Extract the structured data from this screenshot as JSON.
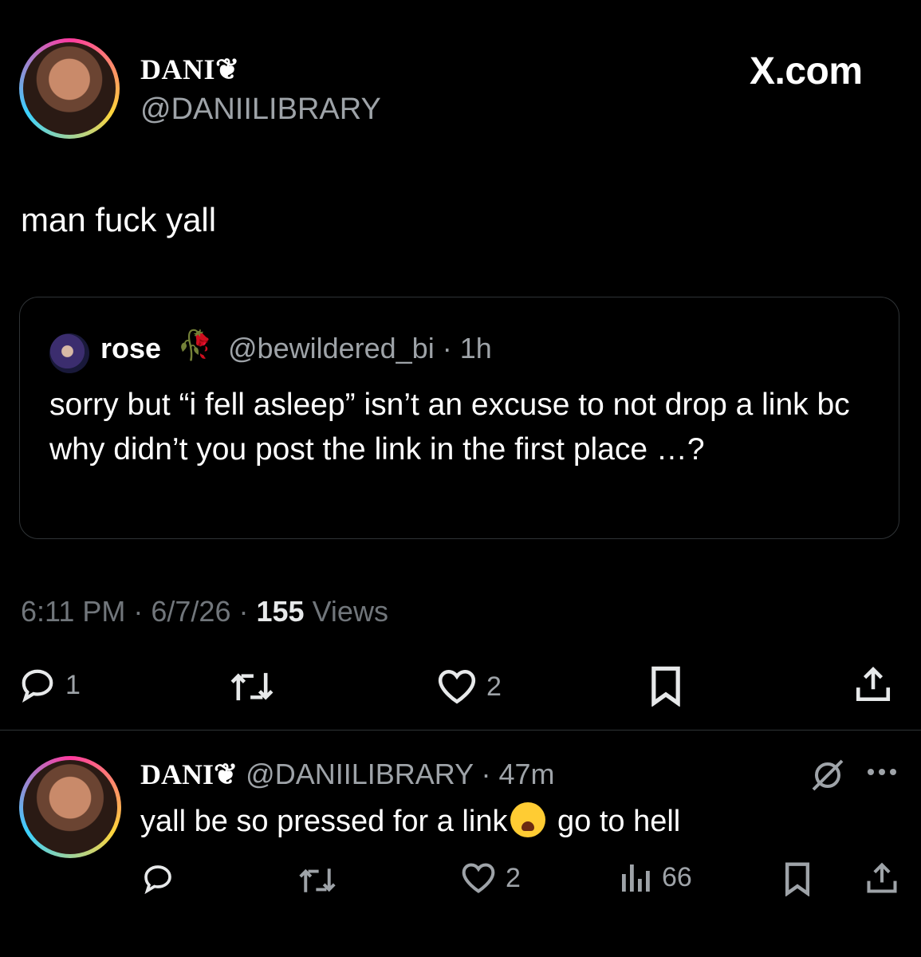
{
  "header": {
    "display_name": "DANI❦",
    "handle": "@DANIILIBRARY",
    "site_logo": "X.com"
  },
  "tweet": {
    "text": "man fuck yall",
    "quote": {
      "name": "rose",
      "name_emoji": "🥀",
      "handle_time": "@bewildered_bi · 1h",
      "text": "sorry but “i fell asleep” isn’t an excuse to not drop a link bc why didn’t you post the link in the first place …?"
    },
    "meta": {
      "time_date": "6:11 PM · 6/7/26 · ",
      "views_count": "155",
      "views_label": " Views"
    },
    "actions": {
      "reply_count": "1",
      "like_count": "2"
    }
  },
  "reply": {
    "name": "DANI❦",
    "handle_time": " @DANIILIBRARY · 47m",
    "text_before": "yall be so pressed for a link",
    "text_after": " go to hell",
    "actions": {
      "like_count": "2",
      "views_count": "66"
    }
  },
  "colors": {
    "background": "#000000",
    "primary_text": "#e7e9ea",
    "secondary_text": "#9ea3a8",
    "border": "#2f3336"
  }
}
